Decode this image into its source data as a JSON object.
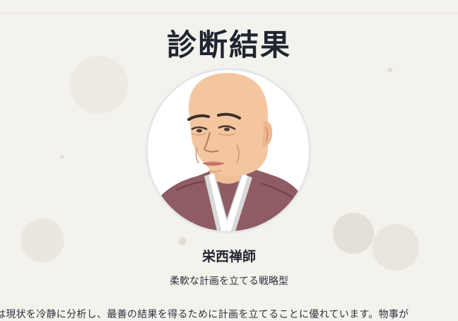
{
  "result": {
    "title": "診断結果",
    "name": "栄西禅師",
    "type": "柔軟な計画を立てる戦略型",
    "description": "は現状を冷静に分析し、最善の結果を得るために計画を立てることに優れています。物事が"
  },
  "portrait": {
    "subject": "monk-portrait",
    "robe_color": "#8e5c62",
    "skin_color": "#f4c6a0",
    "collar_color": "#ffffff"
  }
}
